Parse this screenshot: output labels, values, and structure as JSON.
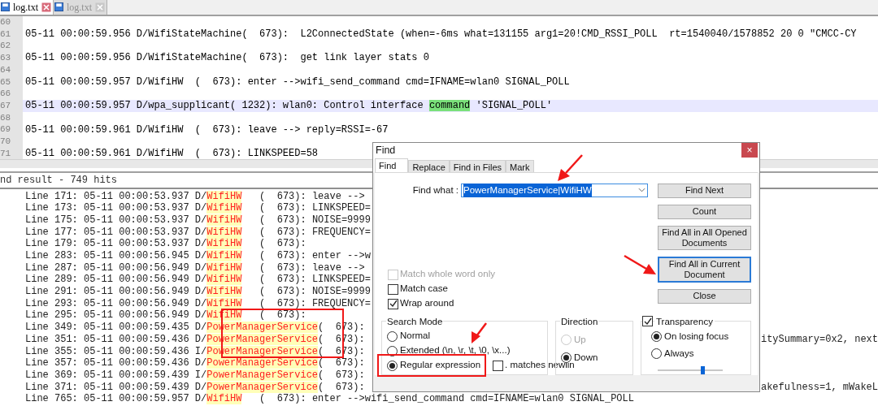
{
  "tabs": [
    {
      "label": "log.txt",
      "selected": true
    },
    {
      "label": "log.txt",
      "selected": false
    }
  ],
  "editor": {
    "lines": [
      {
        "number": "60",
        "current": false
      },
      {
        "number": "61",
        "text": "05-11 00:00:59.956 D/WifiStateMachine(  673):  L2ConnectedState (when=-6ms what=131155 arg1=20!CMD_RSSI_POLL  rt=1540040/1578852 20 0 \"CMCC-CY",
        "current": false
      },
      {
        "number": "62",
        "current": false
      },
      {
        "number": "63",
        "text": "05-11 00:00:59.956 D/WifiStateMachine(  673):  get link layer stats 0",
        "current": false
      },
      {
        "number": "64",
        "current": false
      },
      {
        "number": "65",
        "text": "05-11 00:00:59.957 D/WifiHW  (  673): enter -->wifi_send_command cmd=IFNAME=wlan0 SIGNAL_POLL",
        "current": false
      },
      {
        "number": "66",
        "current": false
      },
      {
        "number": "67",
        "text": "05-11 00:00:59.957 D/wpa_supplicant( 1232): wlan0: Control interface ",
        "match": "command",
        "after": " 'SIGNAL_POLL'",
        "current": true
      },
      {
        "number": "68",
        "current": false
      },
      {
        "number": "69",
        "text": "05-11 00:00:59.961 D/WifiHW  (  673): leave --> reply=RSSI=-67",
        "current": false
      },
      {
        "number": "70",
        "current": false
      },
      {
        "number": "71",
        "text": "05-11 00:00:59.961 D/WifiHW  (  673): LINKSPEED=58",
        "current": false
      }
    ]
  },
  "results": {
    "header": "nd result - 749 hits",
    "rows": [
      {
        "prefix": "Line 171: 05-11 00:00:53.937 D/",
        "match": "WifiHW",
        "rest": "   (  673): leave -->"
      },
      {
        "prefix": "Line 173: 05-11 00:00:53.937 D/",
        "match": "WifiHW",
        "rest": "   (  673): LINKSPEED="
      },
      {
        "prefix": "Line 175: 05-11 00:00:53.937 D/",
        "match": "WifiHW",
        "rest": "   (  673): NOISE=9999"
      },
      {
        "prefix": "Line 177: 05-11 00:00:53.937 D/",
        "match": "WifiHW",
        "rest": "   (  673): FREQUENCY="
      },
      {
        "prefix": "Line 179: 05-11 00:00:53.937 D/",
        "match": "WifiHW",
        "rest": "   (  673):"
      },
      {
        "prefix": "Line 283: 05-11 00:00:56.945 D/",
        "match": "WifiHW",
        "rest": "   (  673): enter -->w"
      },
      {
        "prefix": "Line 287: 05-11 00:00:56.949 D/",
        "match": "WifiHW",
        "rest": "   (  673): leave -->"
      },
      {
        "prefix": "Line 289: 05-11 00:00:56.949 D/",
        "match": "WifiHW",
        "rest": "   (  673): LINKSPEED="
      },
      {
        "prefix": "Line 291: 05-11 00:00:56.949 D/",
        "match": "WifiHW",
        "rest": "   (  673): NOISE=9999"
      },
      {
        "prefix": "Line 293: 05-11 00:00:56.949 D/",
        "match": "WifiHW",
        "rest": "   (  673): FREQUENCY="
      },
      {
        "prefix": "Line 295: 05-11 00:00:56.949 D/",
        "match": "WifiHW",
        "rest": "   (  673):"
      },
      {
        "prefix": "Line 349: 05-11 00:00:59.435 D/",
        "match": "PowerManagerService",
        "rest": "(  673):"
      },
      {
        "prefix": "Line 351: 05-11 00:00:59.436 D/",
        "match": "PowerManagerService",
        "rest": "(  673):",
        "tail": "itySummary=0x2, next"
      },
      {
        "prefix": "Line 355: 05-11 00:00:59.436 I/",
        "match": "PowerManagerService",
        "rest": "(  673):"
      },
      {
        "prefix": "Line 357: 05-11 00:00:59.436 D/",
        "match": "PowerManagerService",
        "rest": "(  673):"
      },
      {
        "prefix": "Line 369: 05-11 00:00:59.439 I/",
        "match": "PowerManagerService",
        "rest": "(  673):"
      },
      {
        "prefix": "Line 371: 05-11 00:00:59.439 D/",
        "match": "PowerManagerService",
        "rest": "(  673):",
        "tail": "akefulness=1, mWakeL"
      },
      {
        "prefix": "Line 765: 05-11 00:00:59.957 D/",
        "match": "WifiHW",
        "rest": "   (  673): enter -->wifi_send_command cmd=IFNAME=wlan0 SIGNAL_POLL"
      }
    ]
  },
  "dialog": {
    "title": "Find",
    "close": "×",
    "tabs": [
      {
        "label": "Find",
        "selected": true
      },
      {
        "label": "Replace",
        "selected": false
      },
      {
        "label": "Find in Files",
        "selected": false
      },
      {
        "label": "Mark",
        "selected": false
      }
    ],
    "find_what": {
      "label": "Find what :",
      "value": "PowerManagerService|WifiHW"
    },
    "buttons": [
      {
        "label": "Find Next",
        "focused": false
      },
      {
        "label": "Count",
        "focused": false
      },
      {
        "label": "Find All in All Opened Documents",
        "focused": false
      },
      {
        "label": "Find All in Current Document",
        "focused": true
      },
      {
        "label": "Close",
        "focused": false
      }
    ],
    "options": [
      {
        "label": "Match whole word only",
        "checked": false,
        "disabled": true
      },
      {
        "label": "Match case",
        "checked": false,
        "disabled": false
      },
      {
        "label": "Wrap around",
        "checked": true,
        "disabled": false
      }
    ],
    "search_mode": {
      "title": "Search Mode",
      "options": [
        {
          "label": "Normal",
          "selected": false
        },
        {
          "label": "Extended (\\n, \\r, \\t, \\0, \\x...)",
          "selected": false
        },
        {
          "label": "Regular expression",
          "selected": true
        }
      ],
      "newline": {
        "label": ". matches newlin",
        "checked": false
      }
    },
    "direction": {
      "title": "Direction",
      "options": [
        {
          "label": "Up",
          "selected": false,
          "disabled": true
        },
        {
          "label": "Down",
          "selected": true,
          "disabled": false
        }
      ]
    },
    "transparency": {
      "label": "Transparency",
      "checked": true,
      "options": [
        {
          "label": "On losing focus",
          "selected": true
        },
        {
          "label": "Always",
          "selected": false
        }
      ],
      "level": 0.7
    }
  }
}
